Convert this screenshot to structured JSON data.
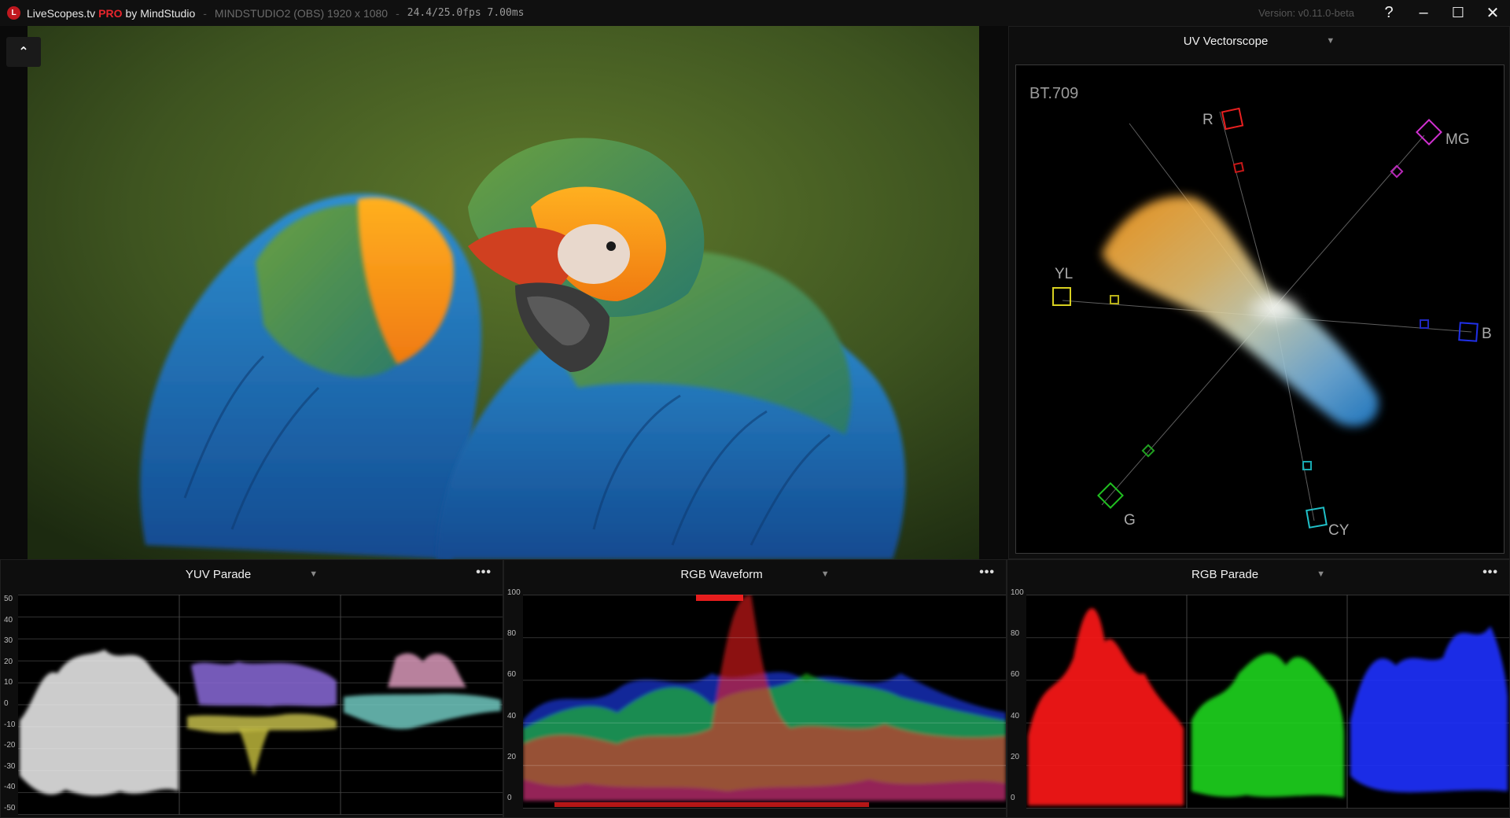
{
  "titlebar": {
    "app_name": "LiveScopes.tv",
    "pro_badge": "PRO",
    "by": "by MindStudio",
    "separator1": "-",
    "source": "MINDSTUDIO2 (OBS) 1920 x 1080",
    "separator2": "-",
    "stats": "24.4/25.0fps 7.00ms",
    "version": "Version: v0.11.0-beta",
    "help": "?",
    "minimize": "–",
    "maximize": "☐",
    "close": "✕"
  },
  "video": {
    "collapse_glyph": "⌃"
  },
  "vectorscope": {
    "title": "UV Vectorscope",
    "standard": "BT.709",
    "targets": {
      "r": "R",
      "mg": "MG",
      "b": "B",
      "cy": "CY",
      "g": "G",
      "yl": "YL"
    }
  },
  "yuv_parade": {
    "title": "YUV Parade",
    "more": "•••",
    "y_ticks": [
      "50",
      "40",
      "30",
      "20",
      "10",
      "0",
      "-10",
      "-20",
      "-30",
      "-40",
      "-50"
    ]
  },
  "rgb_waveform": {
    "title": "RGB Waveform",
    "more": "•••",
    "y_ticks": [
      "100",
      "80",
      "60",
      "40",
      "20",
      "0"
    ]
  },
  "rgb_parade": {
    "title": "RGB Parade",
    "more": "•••",
    "y_ticks": [
      "100",
      "80",
      "60",
      "40",
      "20",
      "0"
    ]
  },
  "colors": {
    "pro": "#e8262d",
    "red": "#ff2020",
    "green": "#20e020",
    "blue": "#2030ff",
    "yellow": "#d8d020",
    "magenta": "#d030d0",
    "cyan": "#20c0c8"
  }
}
